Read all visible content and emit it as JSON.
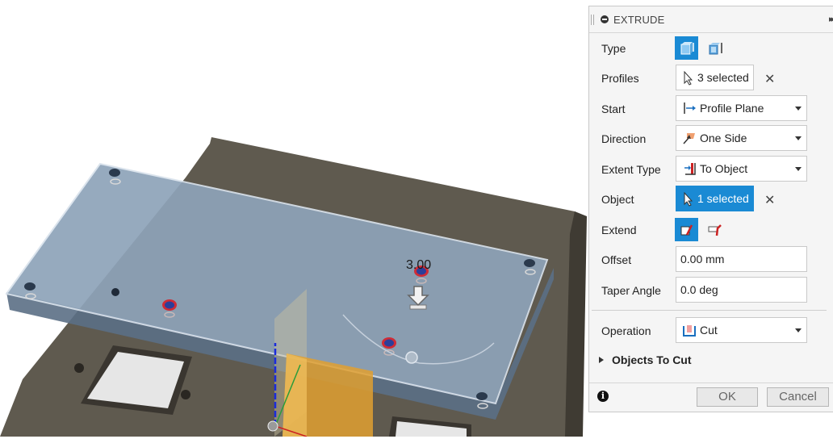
{
  "panel": {
    "title": "EXTRUDE",
    "rows": {
      "type": {
        "label": "Type"
      },
      "profiles": {
        "label": "Profiles",
        "value": "3 selected"
      },
      "start": {
        "label": "Start",
        "value": "Profile Plane"
      },
      "direction": {
        "label": "Direction",
        "value": "One Side"
      },
      "extent_type": {
        "label": "Extent Type",
        "value": "To Object"
      },
      "object": {
        "label": "Object",
        "value": "1 selected"
      },
      "extend": {
        "label": "Extend"
      },
      "offset": {
        "label": "Offset",
        "value": "0.00 mm"
      },
      "taper_angle": {
        "label": "Taper Angle",
        "value": "0.0 deg"
      },
      "operation": {
        "label": "Operation",
        "value": "Cut"
      }
    },
    "objects_to_cut": "Objects To Cut",
    "ok_label": "OK",
    "cancel_label": "Cancel"
  },
  "viewport": {
    "dimension_label": "3.00"
  },
  "colors": {
    "accent": "#1a8ad4",
    "plate": "#8ea3b9",
    "base": "#5a554a",
    "cut_profile": "#e0a030"
  }
}
